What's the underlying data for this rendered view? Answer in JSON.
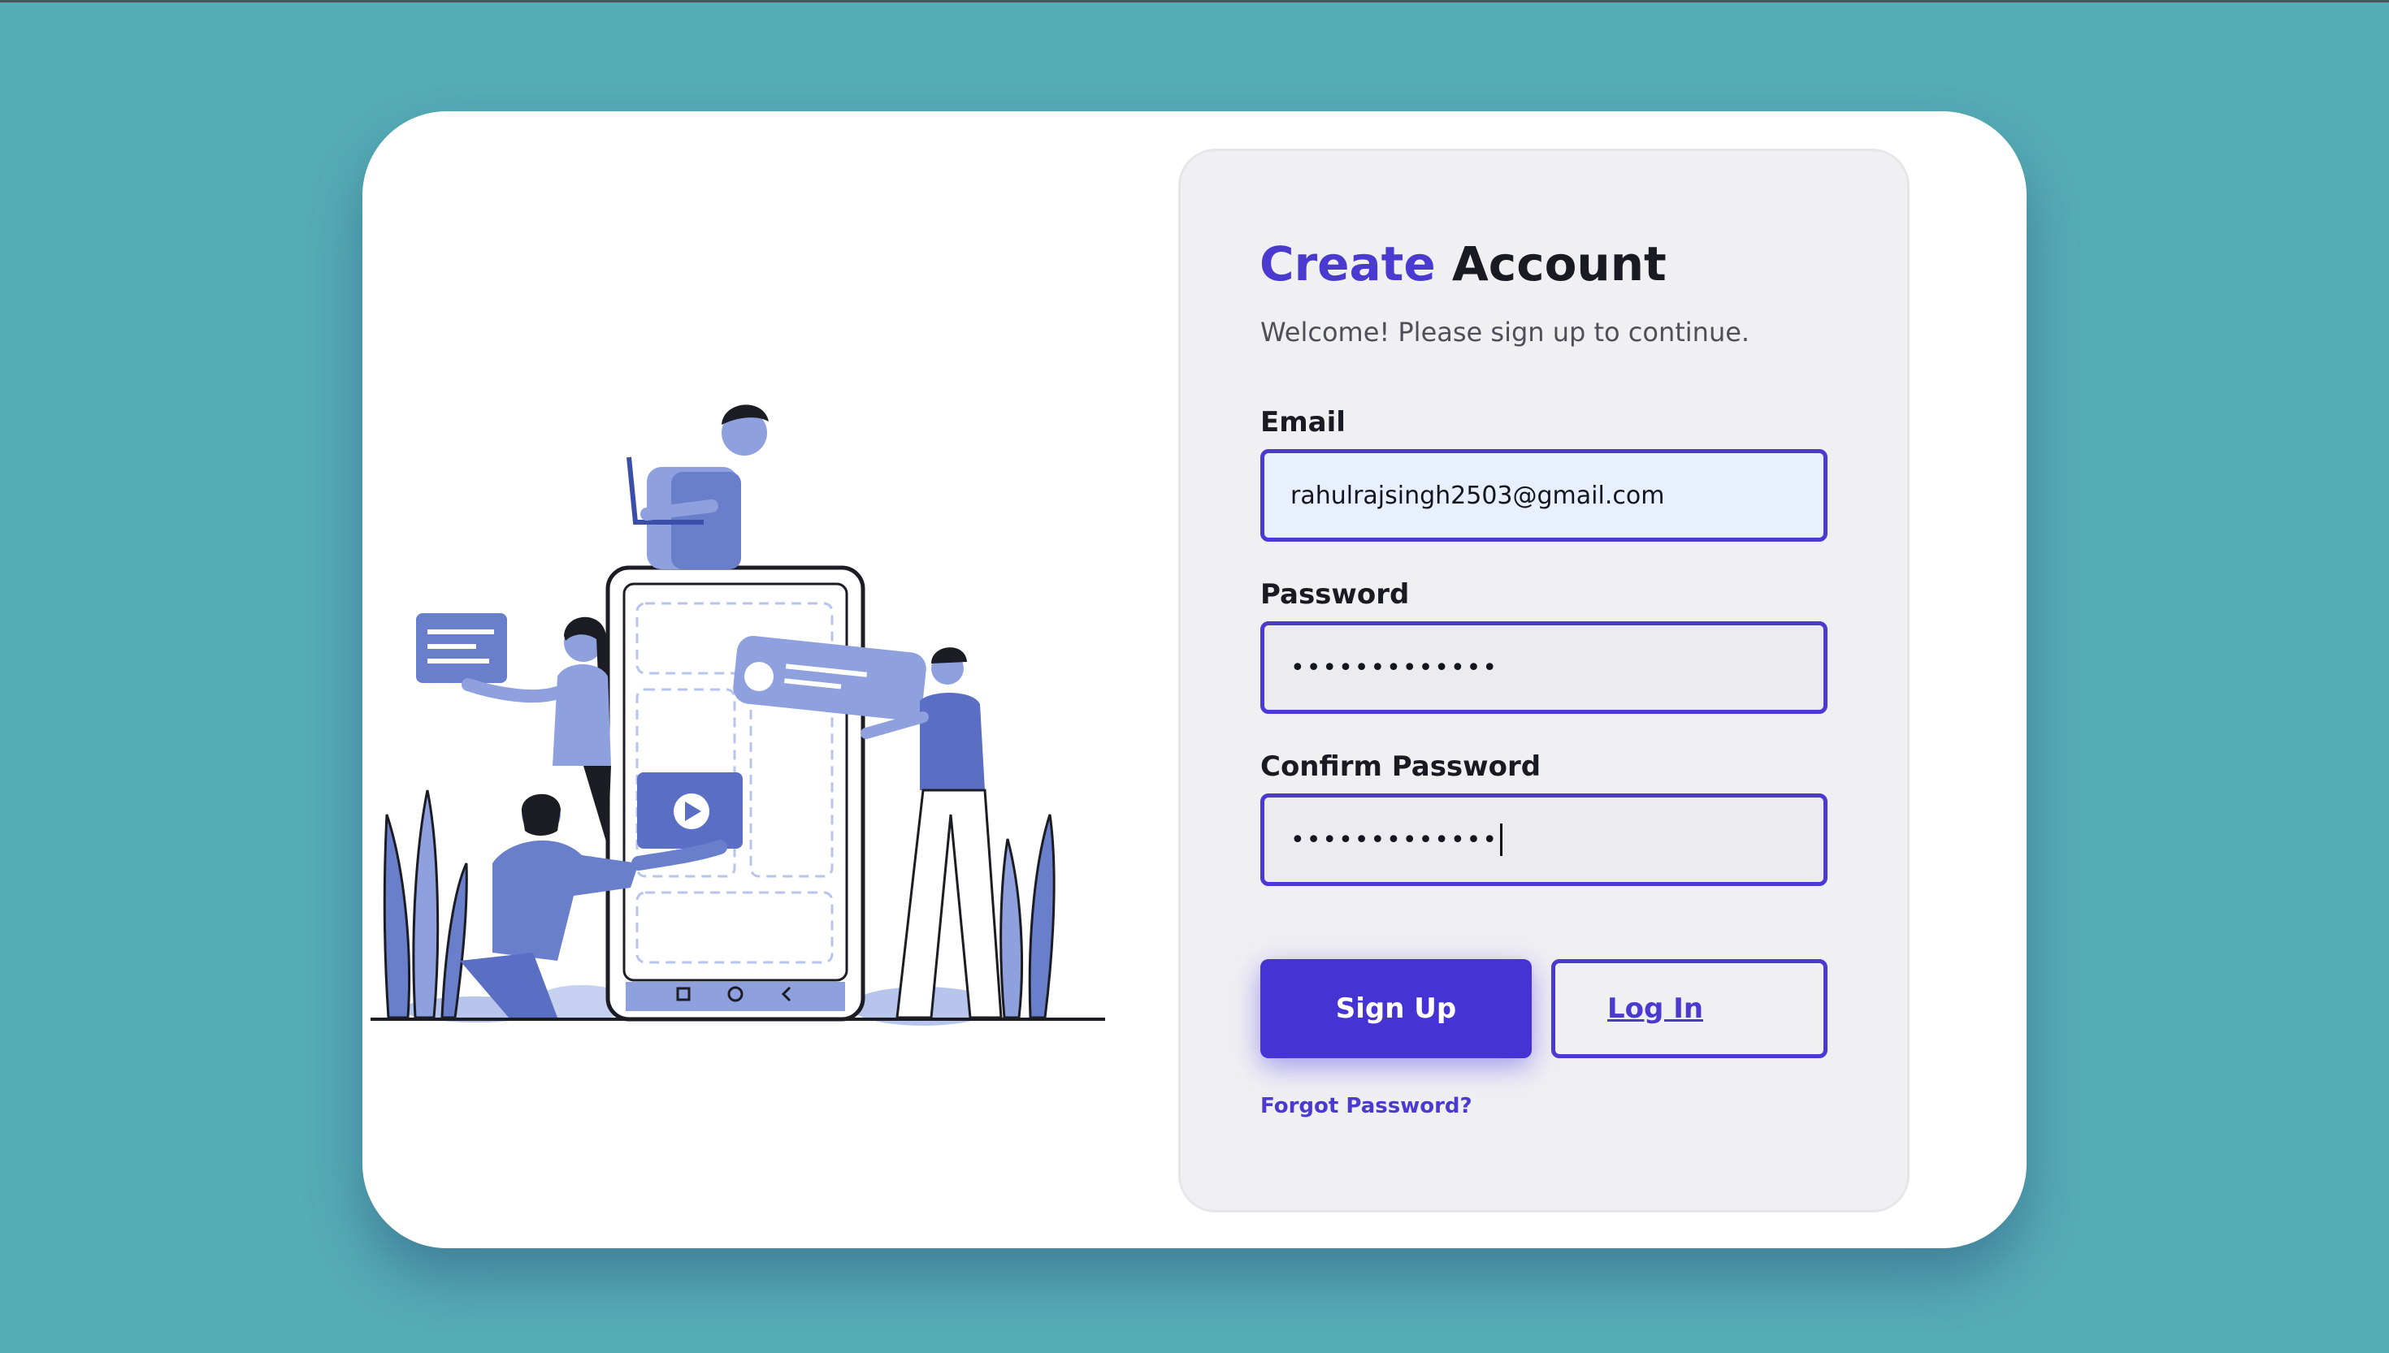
{
  "colors": {
    "background": "#55adb5",
    "accent": "#4a3ad0",
    "primary_button": "#4533d4",
    "illustration": "#6a7fcc"
  },
  "illustration": {
    "icon": "team-building-app-illustration"
  },
  "form": {
    "title_accent": "Create",
    "title_rest": "Account",
    "subtitle": "Welcome! Please sign up to continue.",
    "email": {
      "label": "Email",
      "value": "rahulrajsingh2503@gmail.com"
    },
    "password": {
      "label": "Password",
      "value": "•••••••••••••"
    },
    "confirm_password": {
      "label": "Confirm Password",
      "value": "•••••••••••••"
    },
    "signup_label": "Sign Up",
    "login_label": "Log In",
    "forgot_label": "Forgot Password?"
  }
}
